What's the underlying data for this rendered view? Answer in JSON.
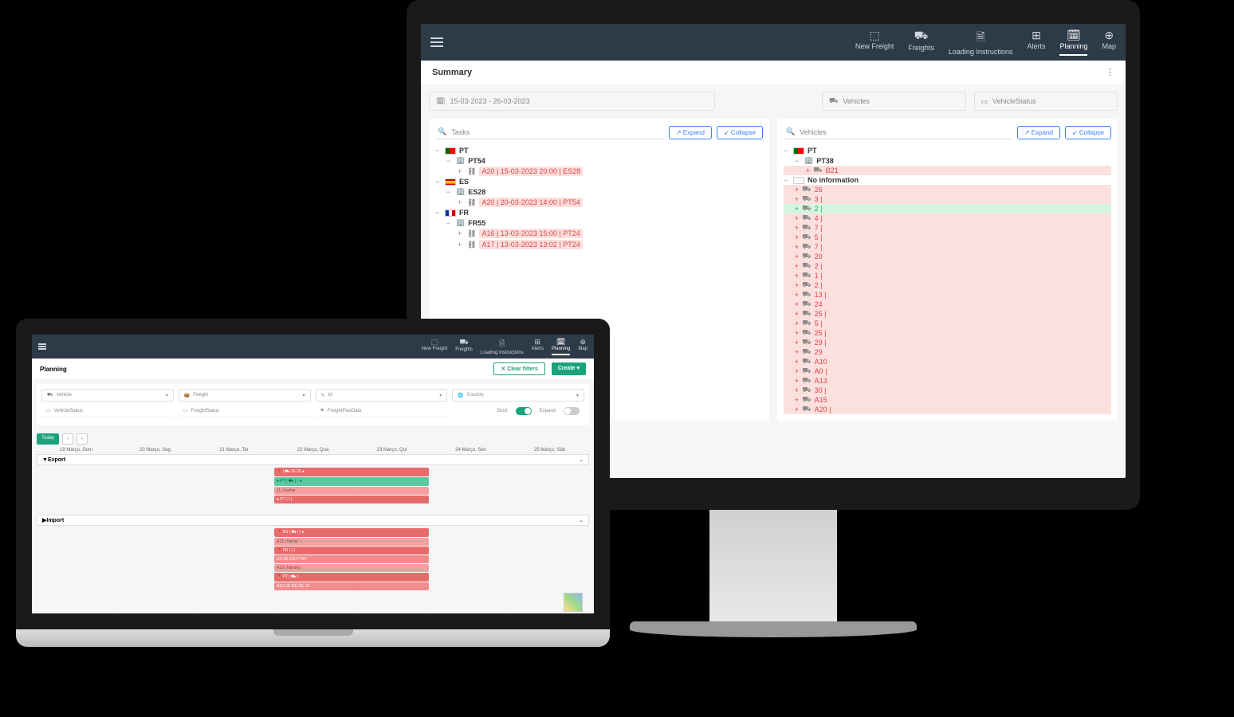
{
  "nav": {
    "newFreight": "New Freight",
    "freights": "Freights",
    "loadingInstructions": "Loading Instructions",
    "alerts": "Alerts",
    "planning": "Planning",
    "map": "Map"
  },
  "summary": {
    "title": "Summary",
    "dateRange": "15-03-2023 - 26-03-2023",
    "vehiclesPlaceholder": "Vehicles",
    "vehicleStatusPlaceholder": "VehicleStatus",
    "tasksPlaceholder": "Tasks",
    "expand": "Expand",
    "collapse": "Collapse",
    "leftTree": {
      "countries": [
        {
          "code": "PT",
          "flag": "pt",
          "locations": [
            {
              "name": "PT54",
              "items": [
                {
                  "label": "A20 | 15-03-2023 20:00 | ES28",
                  "type": "red"
                }
              ]
            }
          ]
        },
        {
          "code": "ES",
          "flag": "es",
          "locations": [
            {
              "name": "ES28",
              "items": [
                {
                  "label": "A20 | 20-03-2023 14:00 | PT54",
                  "type": "red"
                }
              ]
            }
          ]
        },
        {
          "code": "FR",
          "flag": "fr",
          "locations": [
            {
              "name": "FR55",
              "items": [
                {
                  "label": "A16 | 13-03-2023 15:00 | PT24",
                  "type": "red"
                },
                {
                  "label": "A17 | 13-03-2023 13:02 | PT24",
                  "type": "red"
                }
              ]
            }
          ]
        }
      ]
    },
    "rightTree": {
      "root": "PT",
      "group1": "PT38",
      "group1item": "B21",
      "noInfo": "No information",
      "vehicles": [
        {
          "label": "26",
          "type": "red"
        },
        {
          "label": "3 |",
          "type": "red"
        },
        {
          "label": "2 |",
          "type": "green"
        },
        {
          "label": "4 |",
          "type": "red"
        },
        {
          "label": "7 |",
          "type": "red"
        },
        {
          "label": "5 |",
          "type": "red"
        },
        {
          "label": "7 |",
          "type": "red"
        },
        {
          "label": "20",
          "type": "red"
        },
        {
          "label": "2 |",
          "type": "red"
        },
        {
          "label": "1 |",
          "type": "red"
        },
        {
          "label": "2 |",
          "type": "red"
        },
        {
          "label": "13 |",
          "type": "red"
        },
        {
          "label": "24",
          "type": "red"
        },
        {
          "label": "25 |",
          "type": "red"
        },
        {
          "label": "5 |",
          "type": "red"
        },
        {
          "label": "25 |",
          "type": "red"
        },
        {
          "label": "29 |",
          "type": "red"
        },
        {
          "label": "29",
          "type": "red"
        },
        {
          "label": "A10",
          "type": "red"
        },
        {
          "label": "A0 |",
          "type": "red"
        },
        {
          "label": "A13",
          "type": "red"
        },
        {
          "label": "30 |",
          "type": "red"
        },
        {
          "label": "A15",
          "type": "red"
        },
        {
          "label": "A20 |",
          "type": "red"
        }
      ]
    }
  },
  "planning": {
    "title": "Planning",
    "clearFilters": "Clear filters",
    "create": "Create ▾",
    "filters": {
      "vehicle": "Vehicle",
      "freight": "Freight",
      "id": "Id",
      "country": "Country",
      "vehicleStatus": "VehicleStatus",
      "freightStatus": "FreightStatus",
      "freightFlexDate": "FreightFlexDate",
      "strict": "Strict",
      "expand": "Expand"
    },
    "today": "Today",
    "days": [
      "19 Março, Dom",
      "20 Março, Seg",
      "21 Março, Ter",
      "22 Março, Qua",
      "23 Março, Qui",
      "24 Março, Sex",
      "25 Março, Sáb"
    ],
    "sections": {
      "export": "Export",
      "import": "Import"
    },
    "exportEvents": [
      {
        "cls": "ev-red",
        "label": "📍 | ⛟ 25     25 ●"
      },
      {
        "cls": "ev-green",
        "label": "● PT | ⛟ |        ↓ ●"
      },
      {
        "cls": "ev-pink",
        "label": "11 |    harhar"
      },
      {
        "cls": "ev-red",
        "label": "● PT  ☐ |"
      }
    ],
    "importEvents": [
      {
        "cls": "ev-red",
        "label": "📍 ES | ⛟ |        | ●"
      },
      {
        "cls": "ev-pink",
        "label": "A11 |    harhar  --"
      },
      {
        "cls": "ev-red",
        "label": "📍 FR  ☐ |"
      },
      {
        "cls": "ev-red2",
        "label": "US-DE DE PT54"
      },
      {
        "cls": "ev-pink",
        "label": "A10 |        hahaha"
      },
      {
        "cls": "ev-red",
        "label": "📍 PT | ⛟ |"
      },
      {
        "cls": "ev-red2",
        "label": "A10      US-DE DE 10"
      }
    ]
  }
}
